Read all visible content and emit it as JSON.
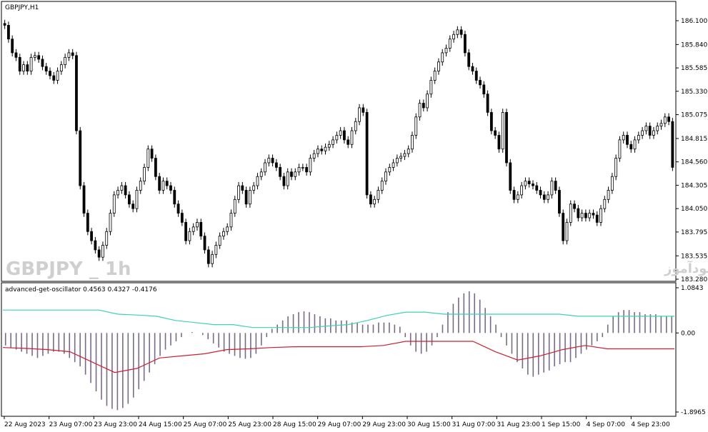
{
  "window": {
    "symbol_title": "GBPJPY,H1",
    "watermark_left": "GBPJPY _ 1h",
    "watermark_right": "انتشار در سایت سودآموز"
  },
  "indicator": {
    "title": "advanced-get-oscillator 0.4563 0.4327 -0.4176"
  },
  "colors": {
    "background": "#ffffff",
    "border": "#000000",
    "candle": "#000000",
    "histogram": "#7a6a8a",
    "upper_line": "#3fd1b4",
    "lower_line": "#cc1f2f"
  },
  "chart_data": [
    {
      "type": "candlestick",
      "title": "GBPJPY,H1",
      "ylim": [
        183.28,
        186.1
      ],
      "y_ticks": [
        "186.100",
        "185.840",
        "185.585",
        "185.330",
        "185.075",
        "184.815",
        "184.560",
        "184.305",
        "184.050",
        "183.795",
        "183.535",
        "183.280"
      ],
      "x_ticks": [
        "22 Aug 2023",
        "23 Aug 07:00",
        "23 Aug 23:00",
        "24 Aug 15:00",
        "25 Aug 07:00",
        "25 Aug 23:00",
        "28 Aug 15:00",
        "29 Aug 07:00",
        "29 Aug 23:00",
        "30 Aug 15:00",
        "31 Aug 07:00",
        "31 Aug 23:00",
        "1 Sep 15:00",
        "4 Sep 07:00",
        "4 Sep 23:00"
      ],
      "series": [
        {
          "close": [
            186.05,
            185.9,
            185.75,
            185.7,
            185.55,
            185.62,
            185.55,
            185.7,
            185.72,
            185.68,
            185.6,
            185.55,
            185.5,
            185.45,
            185.55,
            185.62,
            185.7,
            185.75,
            185.72,
            184.9,
            184.3,
            184.0,
            183.8,
            183.7,
            183.6,
            183.52,
            183.65,
            183.8,
            184.0,
            184.2,
            184.25,
            184.3,
            184.2,
            184.1,
            184.05,
            184.25,
            184.35,
            184.5,
            184.7,
            184.6,
            184.4,
            184.25,
            184.35,
            184.3,
            184.25,
            184.1,
            184.0,
            183.9,
            183.7,
            183.8,
            183.85,
            183.9,
            183.75,
            183.6,
            183.45,
            183.55,
            183.65,
            183.75,
            183.8,
            183.85,
            184.0,
            184.15,
            184.3,
            184.25,
            184.1,
            184.25,
            184.3,
            184.4,
            184.45,
            184.55,
            184.6,
            184.55,
            184.5,
            184.4,
            184.3,
            184.45,
            184.4,
            184.45,
            184.5,
            184.5,
            184.45,
            184.6,
            184.65,
            184.7,
            184.68,
            184.72,
            184.75,
            184.8,
            184.85,
            184.9,
            184.8,
            184.75,
            184.9,
            185.0,
            185.15,
            185.1,
            184.2,
            184.1,
            184.15,
            184.25,
            184.35,
            184.45,
            184.5,
            184.55,
            184.6,
            184.62,
            184.65,
            184.7,
            184.85,
            185.05,
            185.2,
            185.15,
            185.3,
            185.45,
            185.55,
            185.65,
            185.75,
            185.8,
            185.9,
            185.95,
            186.0,
            185.95,
            185.75,
            185.6,
            185.55,
            185.45,
            185.4,
            185.3,
            185.1,
            184.9,
            184.85,
            184.7,
            185.1,
            184.55,
            184.25,
            184.15,
            184.2,
            184.3,
            184.35,
            184.32,
            184.3,
            184.25,
            184.2,
            184.15,
            184.2,
            184.35,
            184.25,
            184.0,
            183.7,
            183.9,
            184.1,
            184.05,
            183.95,
            184.0,
            183.95,
            184.0,
            183.98,
            183.9,
            184.05,
            184.15,
            184.25,
            184.4,
            184.6,
            184.8,
            184.85,
            184.75,
            184.7,
            184.8,
            184.85,
            184.9,
            184.95,
            184.85,
            184.9,
            184.95,
            184.98,
            185.05,
            185.0,
            184.5
          ],
          "count": 182
        }
      ]
    },
    {
      "type": "histogram+line",
      "title": "advanced-get-oscillator 0.4563 0.4327 -0.4176",
      "ylim": [
        -1.8965,
        1.0843
      ],
      "y_ticks": [
        "1.0843",
        "0.00",
        "-1.8965"
      ],
      "series": [
        {
          "name": "histogram",
          "values": [
            -0.3,
            -0.35,
            -0.4,
            -0.45,
            -0.5,
            -0.55,
            -0.6,
            -0.55,
            -0.5,
            -0.45,
            -0.45,
            -0.5,
            -0.6,
            -0.7,
            -0.8,
            -1.0,
            -1.2,
            -1.4,
            -1.6,
            -1.75,
            -1.82,
            -1.85,
            -1.8,
            -1.7,
            -1.55,
            -1.35,
            -1.15,
            -0.95,
            -0.75,
            -0.55,
            -0.4,
            -0.3,
            -0.2,
            -0.1,
            0.0,
            0.02,
            0.0,
            -0.05,
            -0.15,
            -0.25,
            -0.35,
            -0.45,
            -0.5,
            -0.55,
            -0.6,
            -0.62,
            -0.6,
            -0.5,
            -0.3,
            -0.1,
            0.1,
            0.2,
            0.3,
            0.4,
            0.45,
            0.5,
            0.52,
            0.5,
            0.45,
            0.4,
            0.35,
            0.35,
            0.3,
            0.3,
            0.3,
            0.25,
            0.25,
            0.2,
            0.2,
            0.2,
            0.25,
            0.25,
            0.25,
            0.2,
            0.15,
            -0.1,
            -0.3,
            -0.45,
            -0.5,
            -0.45,
            -0.3,
            -0.1,
            0.2,
            0.5,
            0.7,
            0.85,
            0.95,
            1.0,
            0.95,
            0.8,
            0.6,
            0.4,
            0.2,
            -0.1,
            -0.3,
            -0.5,
            -0.7,
            -0.85,
            -1.0,
            -1.05,
            -1.0,
            -0.95,
            -0.9,
            -0.8,
            -0.75,
            -0.7,
            -0.7,
            -0.6,
            -0.5,
            -0.4,
            -0.3,
            -0.2,
            -0.1,
            0.2,
            0.4,
            0.5,
            0.55,
            0.55,
            0.5,
            0.5,
            0.45,
            0.45,
            0.45,
            0.4,
            0.4,
            0.4
          ],
          "color": "#7a6a8a"
        },
        {
          "name": "signal-upper",
          "values": [
            0.55,
            0.55,
            0.55,
            0.55,
            0.55,
            0.55,
            0.45,
            0.43,
            0.4,
            0.3,
            0.25,
            0.2,
            0.2,
            0.13,
            0.13,
            0.13,
            0.13,
            0.17,
            0.2,
            0.3,
            0.42,
            0.5,
            0.5,
            0.45,
            0.45,
            0.45,
            0.45,
            0.45,
            0.45,
            0.45,
            0.4,
            0.4,
            0.4,
            0.4,
            0.4,
            0.4
          ],
          "color": "#3fd1b4"
        },
        {
          "name": "signal-lower",
          "values": [
            -0.35,
            -0.37,
            -0.4,
            -0.45,
            -0.7,
            -0.95,
            -0.85,
            -0.6,
            -0.55,
            -0.5,
            -0.4,
            -0.38,
            -0.35,
            -0.33,
            -0.33,
            -0.33,
            -0.33,
            -0.3,
            -0.2,
            -0.2,
            -0.2,
            -0.2,
            -0.45,
            -0.65,
            -0.55,
            -0.4,
            -0.3,
            -0.38,
            -0.38,
            -0.38,
            -0.38
          ],
          "color": "#cc1f2f"
        }
      ]
    }
  ]
}
